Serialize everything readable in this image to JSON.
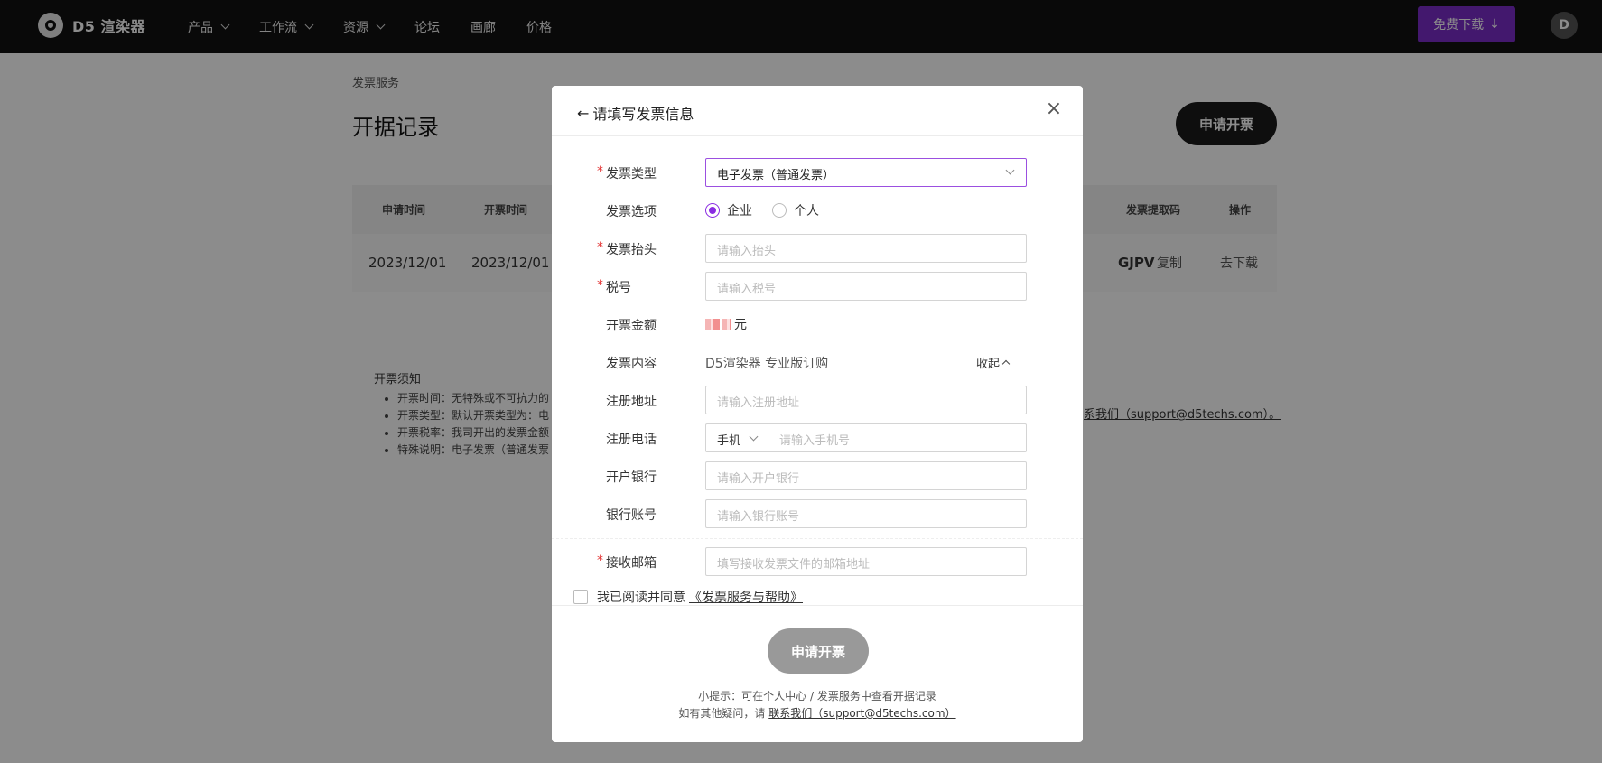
{
  "nav": {
    "logo_text": "D5 渲染器",
    "items": [
      {
        "label": "产品",
        "has_dropdown": true
      },
      {
        "label": "工作流",
        "has_dropdown": true
      },
      {
        "label": "资源",
        "has_dropdown": true
      },
      {
        "label": "论坛",
        "has_dropdown": false
      },
      {
        "label": "画廊",
        "has_dropdown": false
      },
      {
        "label": "价格",
        "has_dropdown": false
      }
    ],
    "download_label": "免费下载",
    "download_icon": "↓",
    "avatar_initial": "D",
    "accent_color": "#7a2cc9"
  },
  "page": {
    "breadcrumb": "发票服务",
    "title": "开据记录",
    "apply_button": "申请开票",
    "table": {
      "headers": {
        "apply_time": "申请时间",
        "issue_time": "开票时间",
        "pickup_code": "发票提取码",
        "action": "操作"
      },
      "row": {
        "apply_time": "2023/12/01",
        "issue_time": "2023/12/01",
        "pickup_code": "GJPV",
        "copy": "复制",
        "download": "去下载"
      }
    },
    "notes": {
      "title": "开票须知",
      "items": [
        "开票时间：无特殊或不可抗力的",
        "开票类型：默认开票类型为：电",
        "开票税率：我司开出的发票金额",
        "特殊说明：电子发票（普通发票"
      ],
      "contact_link": "系我们（support@d5techs.com）。"
    }
  },
  "modal": {
    "title": "请填写发票信息",
    "back_icon": "←",
    "close_icon": "×",
    "fields": {
      "invoice_type": {
        "label": "发票类型",
        "required": true,
        "value": "电子发票（普通发票）"
      },
      "invoice_option": {
        "label": "发票选项",
        "options": [
          "企业",
          "个人"
        ],
        "selected": "企业"
      },
      "invoice_header": {
        "label": "发票抬头",
        "required": true,
        "placeholder": "请输入抬头"
      },
      "tax_number": {
        "label": "税号",
        "required": true,
        "placeholder": "请输入税号"
      },
      "amount": {
        "label": "开票金额",
        "unit": "元"
      },
      "content": {
        "label": "发票内容",
        "value": "D5渲染器 专业版订购",
        "collapse": "收起"
      },
      "address": {
        "label": "注册地址",
        "placeholder": "请输入注册地址"
      },
      "phone": {
        "label": "注册电话",
        "type": "手机",
        "placeholder": "请输入手机号"
      },
      "bank": {
        "label": "开户银行",
        "placeholder": "请输入开户银行"
      },
      "account": {
        "label": "银行账号",
        "placeholder": "请输入银行账号"
      },
      "email": {
        "label": "接收邮箱",
        "required": true,
        "placeholder": "填写接收发票文件的邮箱地址"
      }
    },
    "required_mark": "*",
    "agree_text": "我已阅读并同意",
    "agree_link": "《发票服务与帮助》",
    "submit": "申请开票",
    "tip1": "小提示：可在个人中心 / 发票服务中查看开据记录",
    "tip2_prefix": "如有其他疑问，请 ",
    "tip2_link": "联系我们（support@d5techs.com）"
  }
}
